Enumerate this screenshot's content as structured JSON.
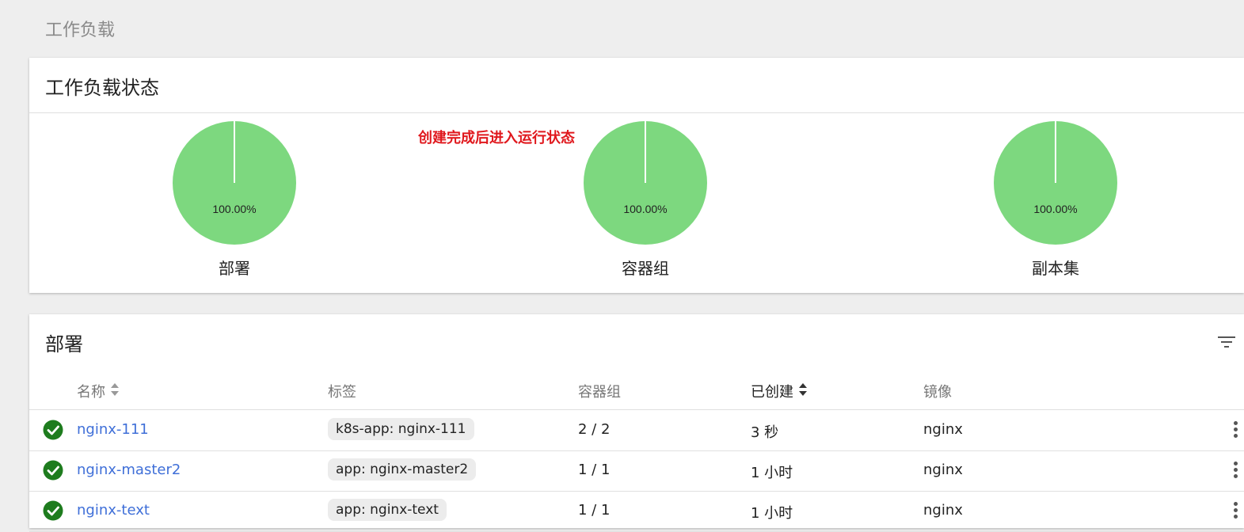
{
  "breadcrumb": "工作负载",
  "status_card": {
    "title": "工作负载状态",
    "annotation": "创建完成后进入运行状态",
    "pies": [
      {
        "label": "部署",
        "percent_text": "100.00%",
        "percent": 100,
        "color": "#7dd87f"
      },
      {
        "label": "容器组",
        "percent_text": "100.00%",
        "percent": 100,
        "color": "#7dd87f"
      },
      {
        "label": "副本集",
        "percent_text": "100.00%",
        "percent": 100,
        "color": "#7dd87f"
      }
    ]
  },
  "deploy_card": {
    "title": "部署",
    "columns": {
      "name": "名称",
      "labels": "标签",
      "pods": "容器组",
      "created": "已创建",
      "image": "镜像"
    },
    "rows": [
      {
        "name": "nginx-111",
        "label": "k8s-app: nginx-111",
        "pods": "2 / 2",
        "created": "3 秒",
        "image": "nginx",
        "status": "ok"
      },
      {
        "name": "nginx-master2",
        "label": "app: nginx-master2",
        "pods": "1 / 1",
        "created": "1 小时",
        "image": "nginx",
        "status": "ok"
      },
      {
        "name": "nginx-text",
        "label": "app: nginx-text",
        "pods": "1 / 1",
        "created": "1 小时",
        "image": "nginx",
        "status": "ok"
      }
    ]
  },
  "colors": {
    "ok_green": "#1e7c1e",
    "link_blue": "#3f6fd8",
    "pie_green": "#7dd87f",
    "annotation_red": "#e0181d"
  },
  "icons": {
    "status": "check-circle-icon",
    "filter": "filter-icon",
    "sort": "sort-icon",
    "more": "more-vert-icon"
  }
}
